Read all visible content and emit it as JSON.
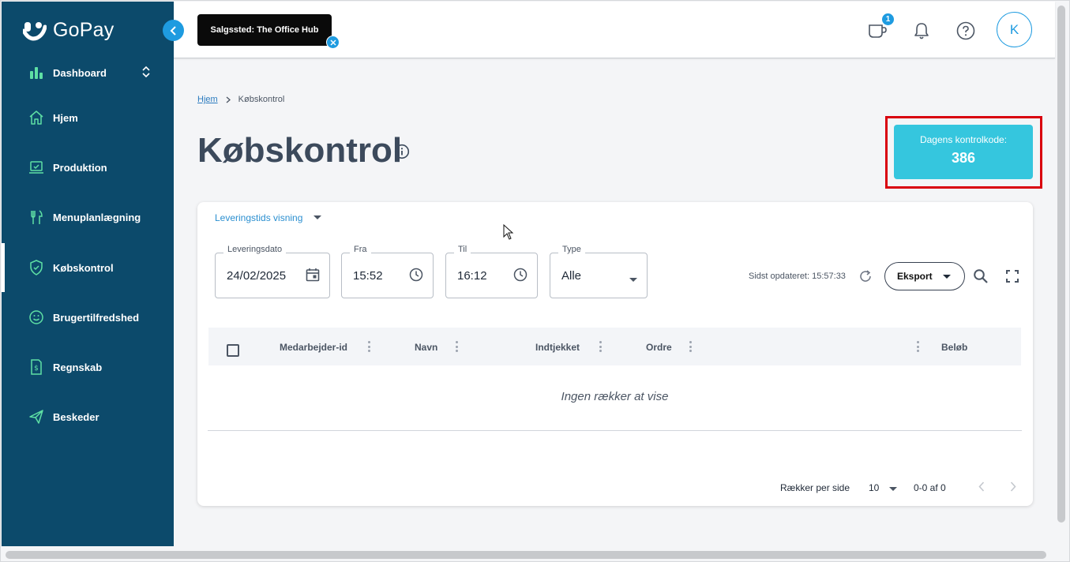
{
  "app": {
    "brand": "GoPay",
    "accent": "#1e9be0",
    "sidebar_color": "#0c4a6b",
    "icon_color": "#5ee0a4"
  },
  "sidebar": {
    "dashboard_label": "Dashboard",
    "items": [
      {
        "label": "Hjem",
        "icon": "home-icon"
      },
      {
        "label": "Produktion",
        "icon": "laptop-check-icon"
      },
      {
        "label": "Menuplanlægning",
        "icon": "cutlery-icon"
      },
      {
        "label": "Købskontrol",
        "icon": "shield-check-icon",
        "active": true
      },
      {
        "label": "Brugertilfredshed",
        "icon": "smiley-icon"
      },
      {
        "label": "Regnskab",
        "icon": "invoice-dollar-icon"
      },
      {
        "label": "Beskeder",
        "icon": "paper-plane-icon"
      }
    ]
  },
  "topbar": {
    "store_chip": "Salgssted: The Office Hub",
    "cart_badge": "1",
    "avatar_initial": "K"
  },
  "breadcrumb": {
    "home": "Hjem",
    "current": "Købskontrol"
  },
  "page": {
    "title": "Købskontrol"
  },
  "control_code": {
    "label": "Dagens kontrolkode:",
    "value": "386",
    "color": "#35c6de"
  },
  "filters": {
    "view_select": "Leveringstids visning",
    "delivery_date": {
      "label": "Leveringsdato",
      "value": "24/02/2025"
    },
    "from": {
      "label": "Fra",
      "value": "15:52"
    },
    "to": {
      "label": "Til",
      "value": "16:12"
    },
    "type": {
      "label": "Type",
      "value": "Alle"
    },
    "last_updated": "Sidst opdateret: 15:57:33",
    "export_label": "Eksport"
  },
  "table": {
    "columns": [
      "Medarbejder-id",
      "Navn",
      "Indtjekket",
      "Ordre",
      "Beløb"
    ],
    "empty_message": "Ingen rækker at vise"
  },
  "pagination": {
    "rows_per_page_label": "Rækker per side",
    "rows_per_page": "10",
    "range": "0-0 af 0"
  }
}
